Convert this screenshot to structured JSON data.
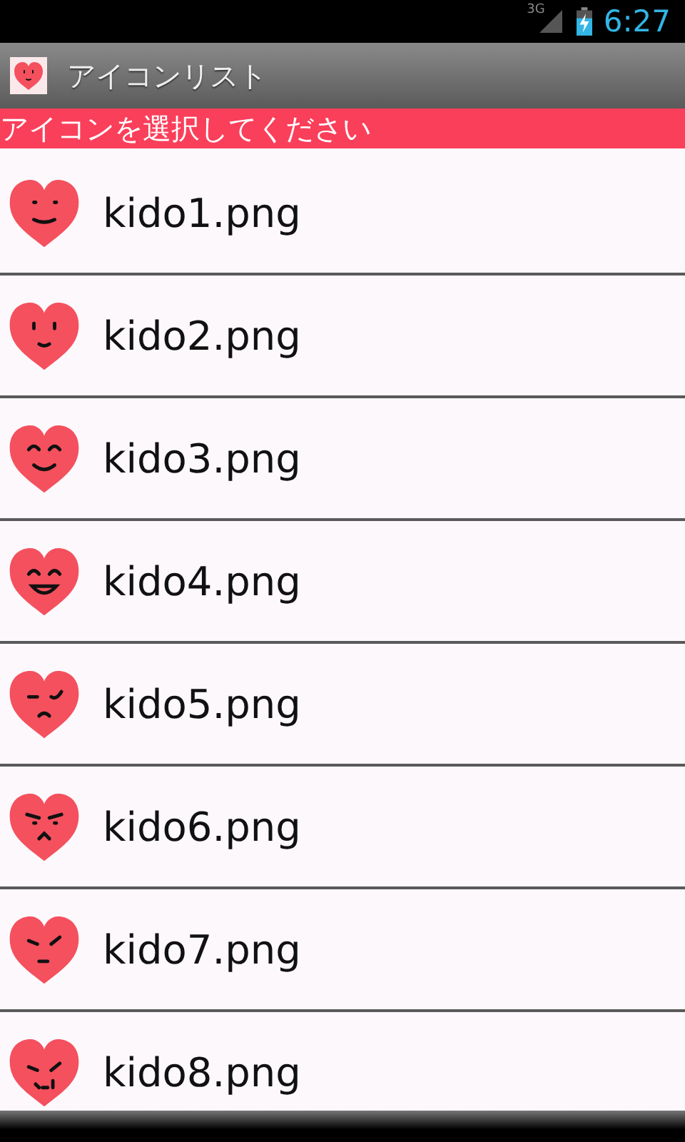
{
  "status_bar": {
    "network": "3G",
    "time": "6:27"
  },
  "title_bar": {
    "title": "アイコンリスト"
  },
  "prompt": "アイコンを選択してください",
  "items": [
    {
      "label": "kido1.png"
    },
    {
      "label": "kido2.png"
    },
    {
      "label": "kido3.png"
    },
    {
      "label": "kido4.png"
    },
    {
      "label": "kido5.png"
    },
    {
      "label": "kido6.png"
    },
    {
      "label": "kido7.png"
    },
    {
      "label": "kido8.png"
    }
  ]
}
